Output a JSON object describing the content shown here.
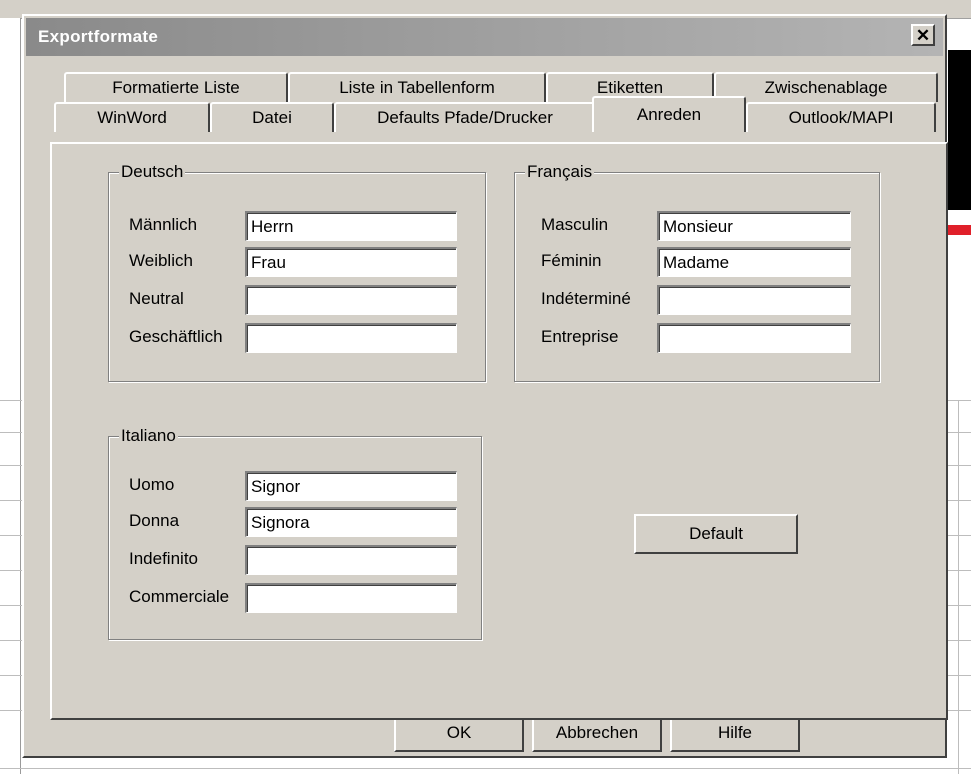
{
  "dialog": {
    "title": "Exportformate",
    "close_symbol": "✕"
  },
  "tabs_row_back": [
    {
      "label": "Formatierte Liste"
    },
    {
      "label": "Liste in Tabellenform"
    },
    {
      "label": "Etiketten"
    },
    {
      "label": "Zwischenablage"
    }
  ],
  "tabs_row_front": [
    {
      "label": "WinWord"
    },
    {
      "label": "Datei"
    },
    {
      "label": "Defaults Pfade/Drucker"
    },
    {
      "label": "Anreden",
      "active": true
    },
    {
      "label": "Outlook/MAPI"
    }
  ],
  "groups": {
    "deutsch": {
      "title": "Deutsch",
      "rows": [
        {
          "label": "Männlich",
          "value": "Herrn"
        },
        {
          "label": "Weiblich",
          "value": "Frau"
        },
        {
          "label": "Neutral",
          "value": ""
        },
        {
          "label": "Geschäftlich",
          "value": ""
        }
      ]
    },
    "francais": {
      "title": "Français",
      "rows": [
        {
          "label": "Masculin",
          "value": "Monsieur"
        },
        {
          "label": "Féminin",
          "value": "Madame"
        },
        {
          "label": "Indéterminé",
          "value": ""
        },
        {
          "label": "Entreprise",
          "value": ""
        }
      ]
    },
    "italiano": {
      "title": "Italiano",
      "rows": [
        {
          "label": "Uomo",
          "value": "Signor"
        },
        {
          "label": "Donna",
          "value": "Signora"
        },
        {
          "label": "Indefinito",
          "value": ""
        },
        {
          "label": "Commerciale",
          "value": ""
        }
      ]
    }
  },
  "buttons": {
    "default_label": "Default",
    "ok_label": "OK",
    "cancel_label": "Abbrechen",
    "help_label": "Hilfe"
  }
}
